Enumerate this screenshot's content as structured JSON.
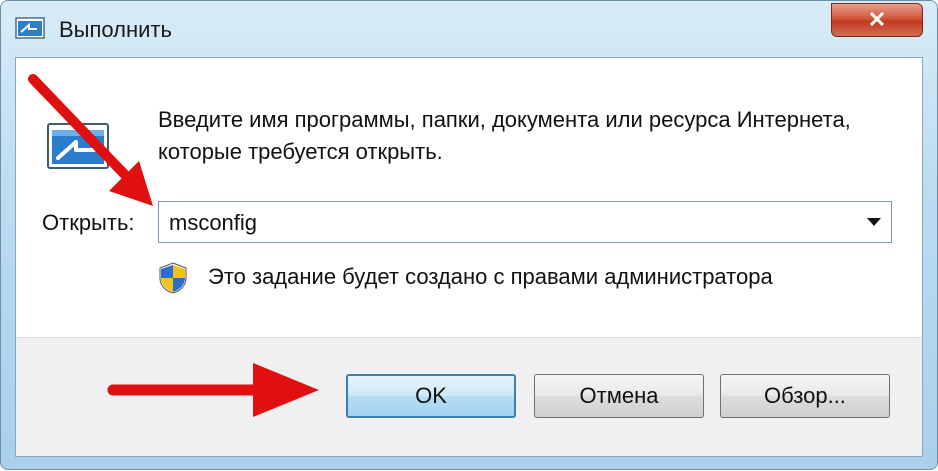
{
  "window": {
    "title": "Выполнить",
    "close_label": "✕"
  },
  "dialog": {
    "description": "Введите имя программы, папки, документа или ресурса Интернета, которые требуется открыть.",
    "open_label": "Открыть:",
    "open_value": "msconfig",
    "admin_note": "Это задание будет создано с правами администратора"
  },
  "buttons": {
    "ok": "OK",
    "cancel": "Отмена",
    "browse": "Обзор..."
  },
  "icons": {
    "title": "run-icon",
    "main": "run-icon",
    "admin": "uac-shield-icon",
    "dropdown": "chevron-down-icon",
    "annotation": "red-arrow-icon"
  },
  "colors": {
    "annotation_arrow": "#e01010",
    "ok_border": "#3c7fb1",
    "close_button": "#c0391f"
  }
}
